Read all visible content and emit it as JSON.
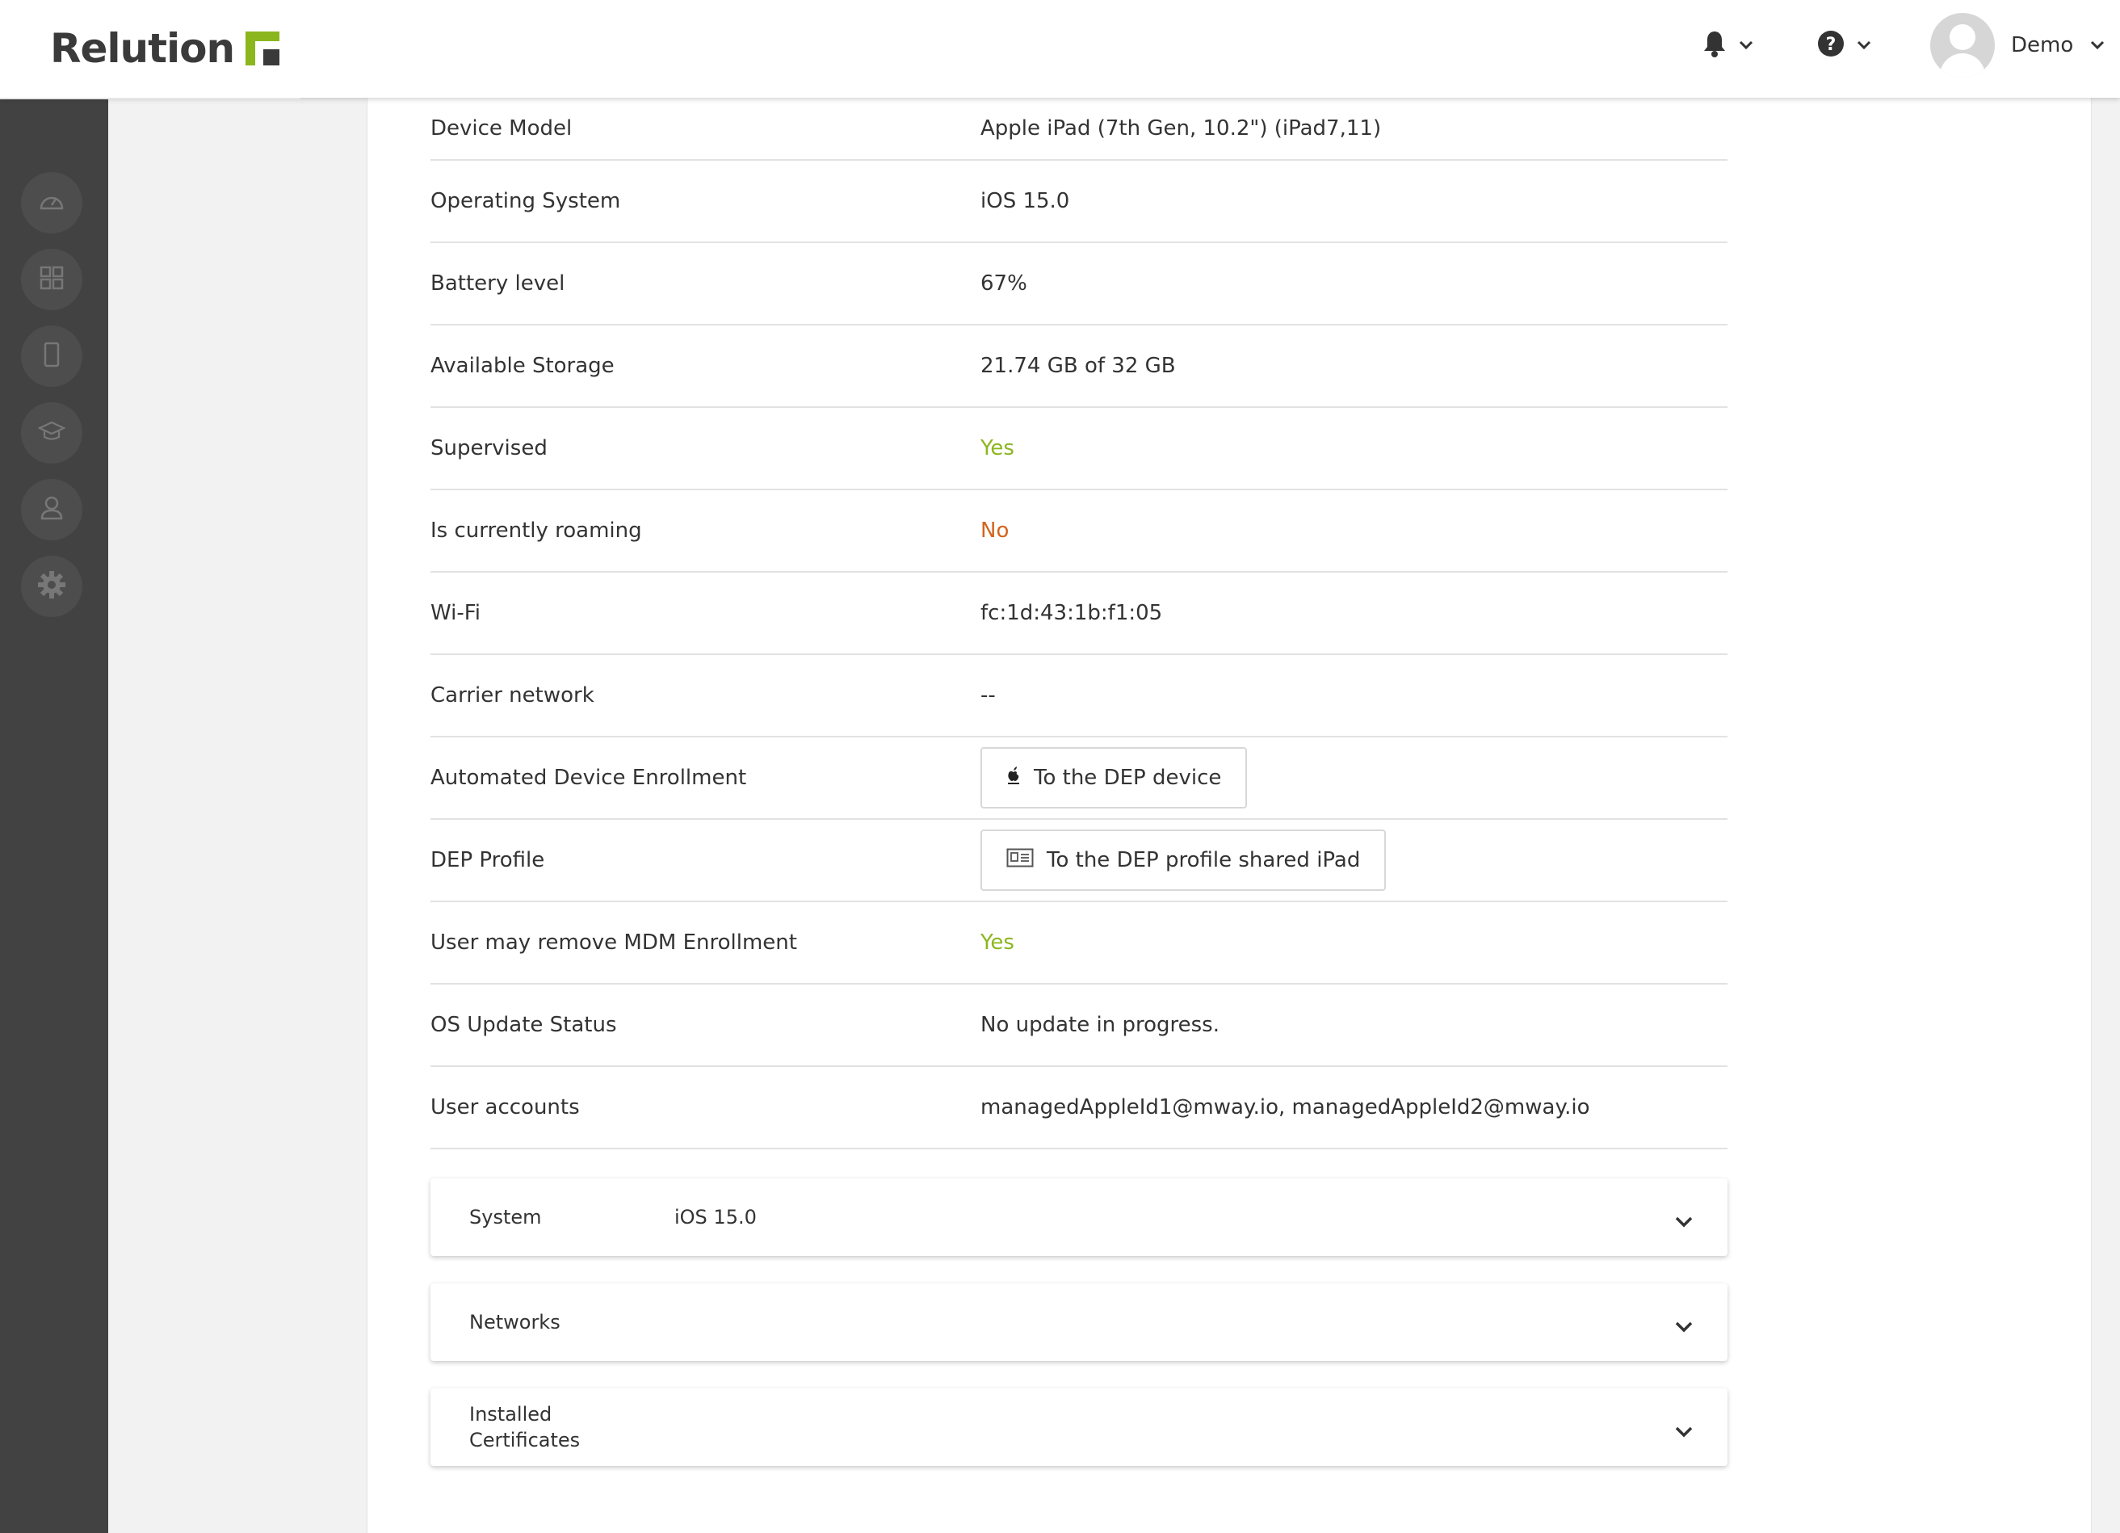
{
  "header": {
    "logo_text": "Relution",
    "user_name": "Demo",
    "icons": [
      "bell-icon",
      "help-icon",
      "user-avatar"
    ]
  },
  "sidebar": {
    "items": [
      "dashboard-icon",
      "apps-icon",
      "devices-icon",
      "education-icon",
      "users-icon",
      "settings-icon"
    ]
  },
  "details": {
    "device_model_label": "Device Model",
    "device_model_value": "Apple iPad (7th Gen, 10.2\") (iPad7,11)",
    "os_label": "Operating System",
    "os_value": "iOS 15.0",
    "battery_label": "Battery level",
    "battery_value": "67%",
    "storage_label": "Available Storage",
    "storage_value": "21.74 GB of 32 GB",
    "supervised_label": "Supervised",
    "supervised_value": "Yes",
    "roaming_label": "Is currently roaming",
    "roaming_value": "No",
    "wifi_label": "Wi-Fi",
    "wifi_value": "fc:1d:43:1b:f1:05",
    "carrier_label": "Carrier network",
    "carrier_value": "--",
    "ade_label": "Automated Device Enrollment",
    "ade_button": "To the DEP device",
    "dep_label": "DEP Profile",
    "dep_button": "To the DEP profile shared iPad",
    "remove_mdm_label": "User may remove MDM Enrollment",
    "remove_mdm_value": "Yes",
    "os_update_label": "OS Update Status",
    "os_update_value": "No update in progress.",
    "accounts_label": "User accounts",
    "accounts_value": "managedAppleId1@mway.io, managedAppleId2@mway.io"
  },
  "accordions": {
    "system_label": "System",
    "system_value": "iOS 15.0",
    "networks_label": "Networks",
    "certs_line1": "Installed",
    "certs_line2": "Certificates"
  },
  "colors": {
    "accent_green": "#8cb61e",
    "negative_orange": "#d4641c",
    "sidebar_bg": "#424242"
  }
}
